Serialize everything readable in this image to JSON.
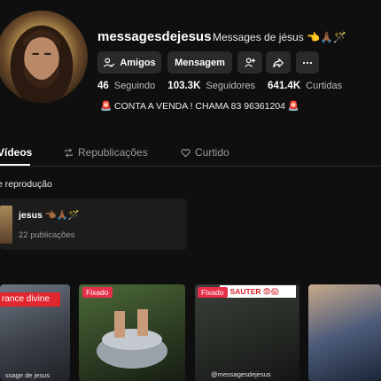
{
  "profile": {
    "username": "messagesdejesus",
    "nickname": "Messages de jésus 👈🙏🏾🪄",
    "bio": "🚨 CONTA A VENDA ! CHAMA 83 96361204 🚨"
  },
  "actions": {
    "friends": "Amigos",
    "message": "Mensagem"
  },
  "stats": {
    "following_count": "46",
    "following_label": "Seguindo",
    "followers_count": "103.3K",
    "followers_label": "Seguidores",
    "likes_count": "641.4K",
    "likes_label": "Curtidas"
  },
  "tabs": {
    "videos": "Vídeos",
    "reposts": "Republicações",
    "liked": "Curtido"
  },
  "playlists": {
    "section_title": "e reprodução",
    "items": [
      {
        "title": "jesus 👈🏾🙏🏾🪄",
        "count": "22 publicações"
      }
    ]
  },
  "videos": {
    "pinned_label": "Fixado",
    "items": [
      {
        "overlay": "rance divine",
        "watermark": "ssage de jesus"
      },
      {
        "overlay": ""
      },
      {
        "overlay": "T SAUTER 😨😱",
        "watermark": "@messagesdejesus"
      },
      {
        "overlay": ""
      }
    ]
  }
}
